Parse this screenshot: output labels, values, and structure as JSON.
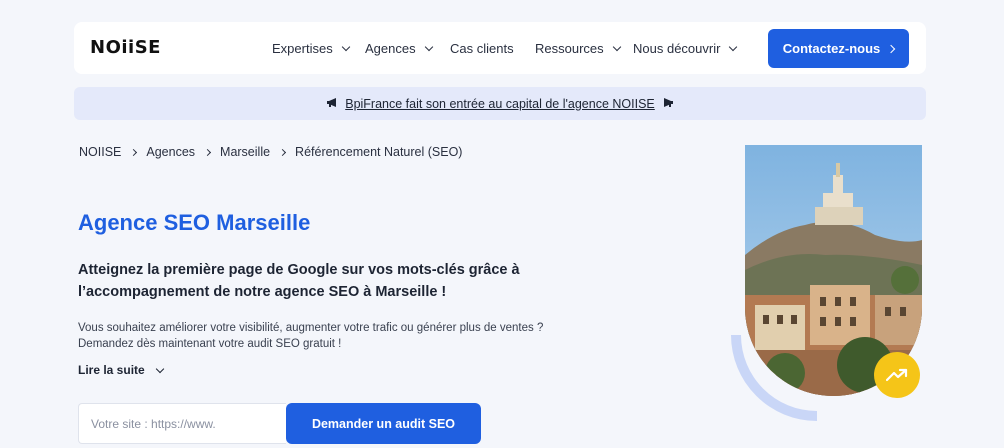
{
  "header": {
    "logo": "NOiiSE",
    "nav": [
      {
        "label": "Expertises",
        "dropdown": true
      },
      {
        "label": "Agences",
        "dropdown": true
      },
      {
        "label": "Cas clients",
        "dropdown": false
      },
      {
        "label": "Ressources",
        "dropdown": true
      },
      {
        "label": "Nous découvrir",
        "dropdown": true
      }
    ],
    "cta_label": "Contactez-nous"
  },
  "banner": {
    "text": "BpiFrance fait son entrée au capital de l'agence NOIISE",
    "icon": "megaphone-icon"
  },
  "breadcrumb": [
    "NOIISE",
    "Agences",
    "Marseille",
    "Référencement Naturel (SEO)"
  ],
  "main": {
    "title": "Agence SEO Marseille",
    "subtitle": "Atteignez la première page de Google sur vos mots-clés grâce à l’accompagnement de notre agence SEO à Marseille !",
    "body_line1": "Vous souhaitez améliorer votre visibilité, augmenter votre trafic ou générer plus de ventes ?",
    "body_line2": "Demandez dès maintenant votre audit SEO gratuit !",
    "read_more": "Lire la suite",
    "form": {
      "placeholder": "Votre site : https://www.",
      "value": "",
      "button": "Demander un audit SEO"
    }
  },
  "colors": {
    "accent": "#1f5fe0",
    "banner_bg": "#e4e9fa",
    "badge": "#f5c518"
  }
}
